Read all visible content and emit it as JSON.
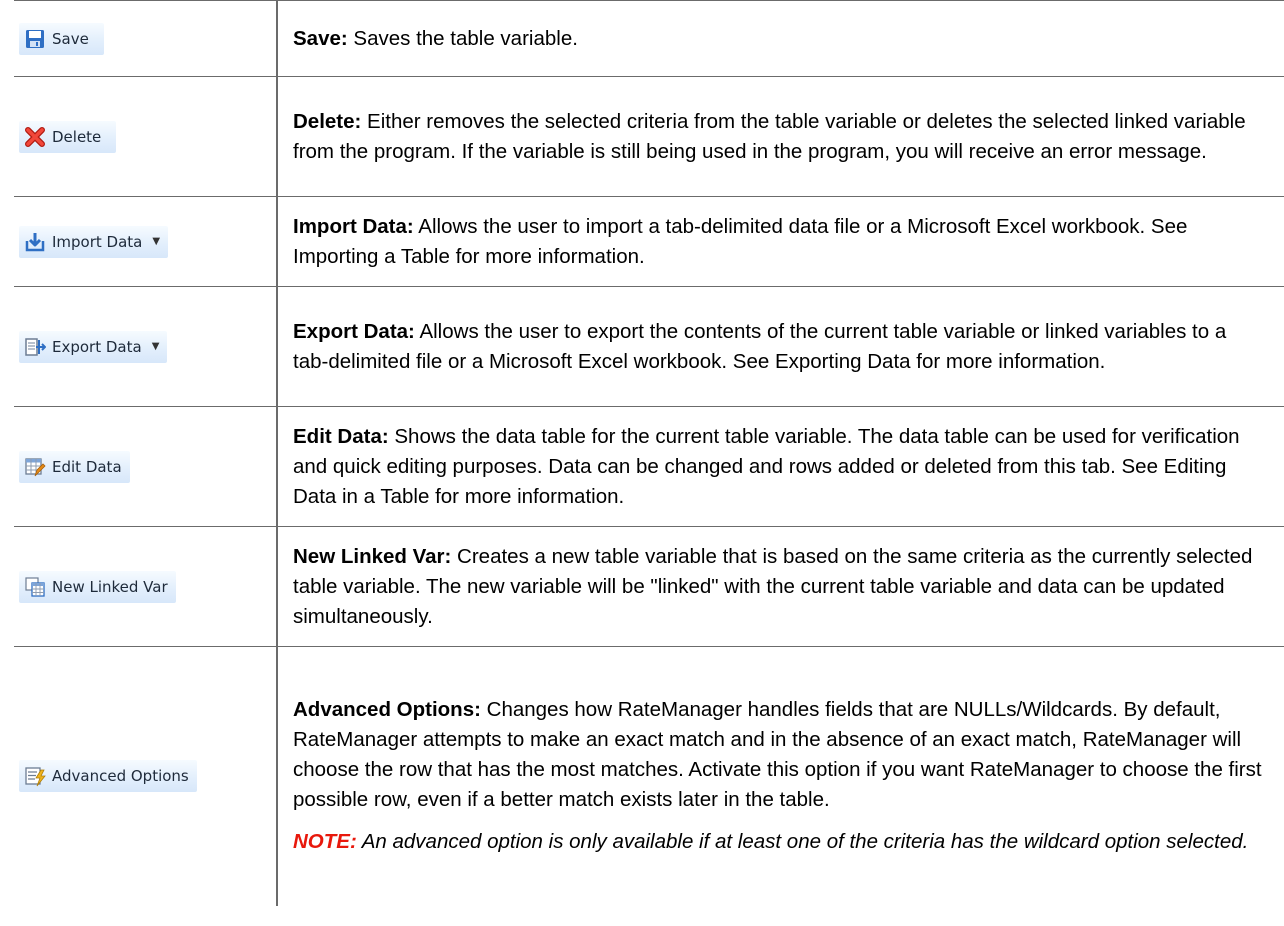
{
  "rows": [
    {
      "button": {
        "label": "Save",
        "icon": "save-icon"
      },
      "term": "Save:",
      "text": " Saves the table variable."
    },
    {
      "button": {
        "label": "Delete",
        "icon": "delete-icon"
      },
      "term": "Delete:",
      "text": " Either removes the selected criteria from the table variable or deletes the selected linked variable from the program. If the variable is still being used in the program, you will receive an error message."
    },
    {
      "button": {
        "label": "Import Data",
        "icon": "import-icon",
        "dropdown": "▼"
      },
      "term": "Import Data:",
      "text": " Allows the user to import a tab-delimited data file or a Microsoft Excel workbook. See Importing a Table for more information."
    },
    {
      "button": {
        "label": "Export Data",
        "icon": "export-icon",
        "dropdown": "▼"
      },
      "term": "Export Data:",
      "text": " Allows the user to export the contents of the current table variable or linked variables to a tab-delimited file or a Microsoft Excel workbook. See Exporting Data for more information."
    },
    {
      "button": {
        "label": "Edit Data",
        "icon": "edit-table-icon"
      },
      "term": "Edit Data:",
      "text": " Shows the data table for the current table variable. The data table can be used for verification and quick editing purposes. Data can be changed and rows added or deleted from this tab. See Editing Data in a Table for more information."
    },
    {
      "button": {
        "label": "New Linked Var",
        "icon": "linked-table-icon"
      },
      "term": "New Linked Var:",
      "text": " Creates a new table variable that is based on the same criteria as the currently selected table variable. The new variable will be \"linked\" with the current table variable and data can be updated simultaneously."
    },
    {
      "button": {
        "label": "Advanced Options",
        "icon": "advanced-options-icon"
      },
      "term": "Advanced Options:",
      "text": " Changes how RateManager handles fields that are NULLs/Wildcards. By default, RateManager attempts to make an exact match and in the absence of an exact match, RateManager will choose the row that has the most matches. Activate this option if you want RateManager to choose the first possible row, even if a better match exists later in the table.",
      "note_label": "NOTE:",
      "note_text": " An advanced option is only available if at least one of the criteria has the wildcard option selected."
    }
  ],
  "colors": {
    "accent_toolbar": "#dbe9fb",
    "note_red": "#e8180c",
    "border": "#6b6b6b"
  }
}
